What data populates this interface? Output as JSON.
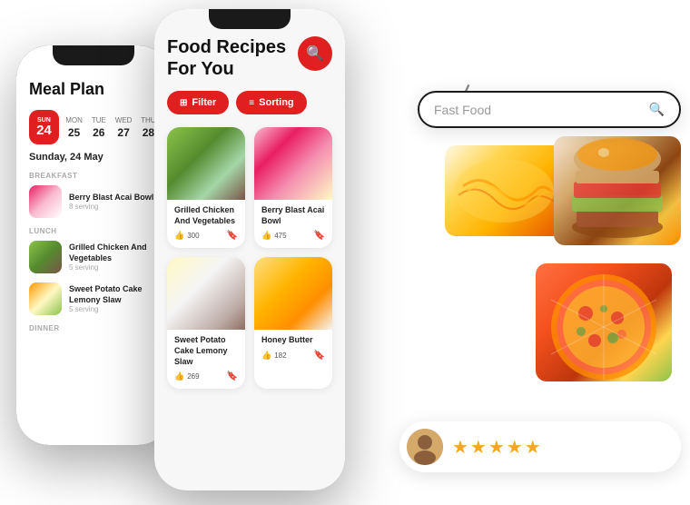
{
  "left_phone": {
    "title": "Meal Plan",
    "calendar": {
      "today_day": "SUN",
      "today_date": "24",
      "days": [
        {
          "name": "MON",
          "date": "25"
        },
        {
          "name": "TUE",
          "date": "26"
        },
        {
          "name": "WED",
          "date": "27"
        },
        {
          "name": "THU",
          "date": "28"
        }
      ]
    },
    "date_label": "Sunday, 24 May",
    "sections": [
      {
        "title": "BREAKFAST",
        "items": [
          {
            "name": "Berry Blast Acai Bowl",
            "serving": "8 serving",
            "thumb_class": "thumb-acai"
          }
        ]
      },
      {
        "title": "LUNCH",
        "items": [
          {
            "name": "Grilled Chicken And Vegetables",
            "serving": "5 serving",
            "thumb_class": "thumb-chicken"
          },
          {
            "name": "Sweet Potato Cake Lemony Slaw",
            "serving": "5 serving",
            "thumb_class": "thumb-cake"
          }
        ]
      },
      {
        "title": "DINNER",
        "items": []
      }
    ]
  },
  "center_phone": {
    "title_line1": "Food Recipes",
    "title_line2": "For You",
    "filter_btn": "Filter",
    "sort_btn": "Sorting",
    "recipes": [
      {
        "name": "Grilled Chicken And Vegetables",
        "likes": "300",
        "img_class": "food-img-1"
      },
      {
        "name": "Berry Blast Acai Bowl",
        "likes": "475",
        "img_class": "food-img-2"
      },
      {
        "name": "Sweet Potato Cake Lemony Slaw",
        "likes": "269",
        "img_class": "food-img-3"
      },
      {
        "name": "Honey Butter",
        "likes": "182",
        "img_class": "food-img-4"
      }
    ]
  },
  "right_panel": {
    "search_placeholder": "Fast Food",
    "review": {
      "stars": "★★★★★"
    }
  },
  "icons": {
    "search": "🔍",
    "filter": "⊞",
    "sort": "≡",
    "like": "👍",
    "bookmark": "🔖",
    "arrow": "↙"
  }
}
